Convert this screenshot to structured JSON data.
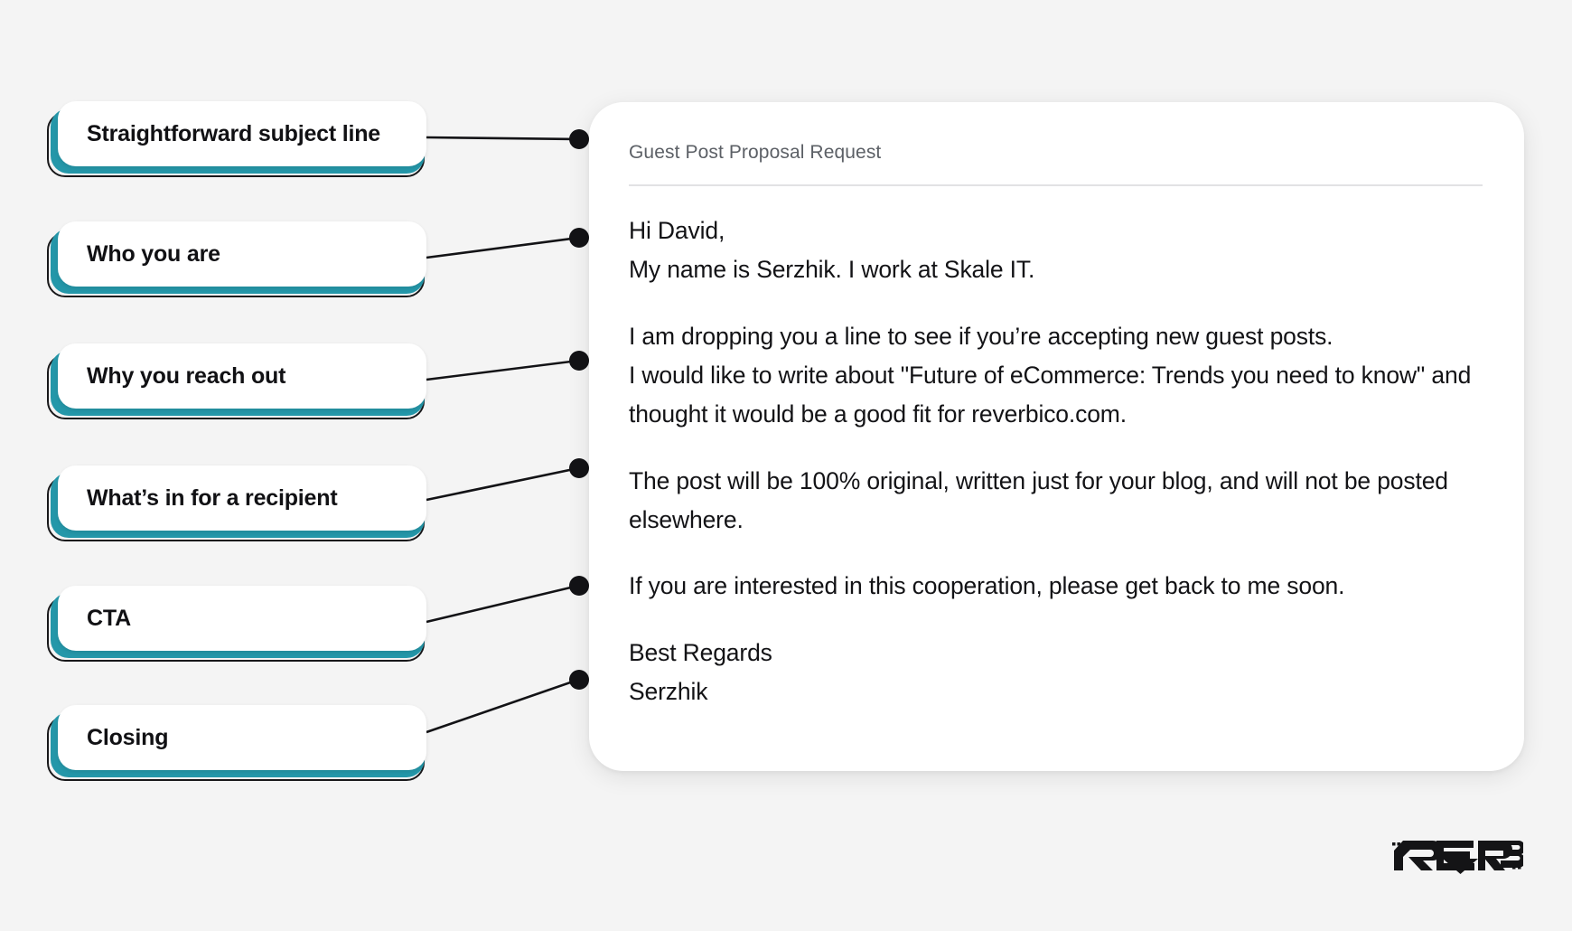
{
  "theme": {
    "background": "#f4f4f4",
    "accent_teal": "#2497a9",
    "outline": "#18181a",
    "panel": "#ffffff",
    "subject_text": "#5c6066",
    "body_text": "#131316",
    "divider": "#e2e2e4"
  },
  "annotations": [
    {
      "id": "subject-line",
      "label": "Straightforward subject line"
    },
    {
      "id": "who-you-are",
      "label": "Who you are"
    },
    {
      "id": "why-reach-out",
      "label": "Why you reach out"
    },
    {
      "id": "whats-in-for-recipient",
      "label": "What’s in for a recipient"
    },
    {
      "id": "cta",
      "label": "CTA"
    },
    {
      "id": "closing",
      "label": "Closing"
    }
  ],
  "email": {
    "subject": "Guest Post Proposal Request",
    "paragraphs": [
      "Hi David,\nMy name is Serzhik. I work at Skale IT.",
      "I am dropping you a line to see if you’re accepting new guest posts.\nI would like to write about \"Future of eCommerce: Trends you need to know\" and thought it would be a good fit for reverbico.com.",
      "The post will be 100% original, written just for your blog, and will not be posted elsewhere.",
      "If you are interested in this cooperation, please get back to me soon.",
      "Best Regards\nSerzhik"
    ]
  },
  "brand": {
    "name": "REVERB"
  }
}
